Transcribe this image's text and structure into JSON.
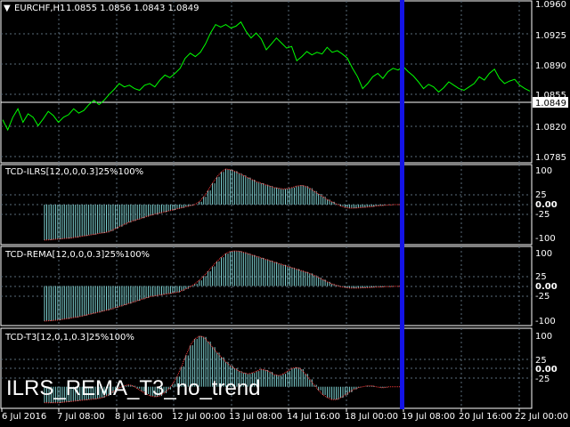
{
  "main": {
    "symbol_tf": "EURCHF,H1",
    "ohlc": "1.0855 1.0856 1.0843 1.0849",
    "price_ticks": [
      "1.0960",
      "1.0925",
      "1.0890",
      "1.0855",
      "1.0820",
      "1.0785"
    ],
    "current_price": "1.0849"
  },
  "indicators": [
    {
      "label": "TCD-ILRS[12,0,0,0.3]25%100%",
      "ticks": [
        "100",
        "25",
        "0.00",
        "-25",
        "-100"
      ]
    },
    {
      "label": "TCD-REMA[12,0,0,0.3]25%100%",
      "ticks": [
        "100",
        "25",
        "0.00",
        "-25",
        "-100"
      ]
    },
    {
      "label": "TCD-T3[12,0,1,0.3]25%100%",
      "ticks": [
        "100",
        "25",
        "0.00",
        "-25"
      ]
    }
  ],
  "overlay_title": "ILRS_REMA_T3_no_trend",
  "time_labels": [
    "6 Jul 2016",
    "7 Jul 08:00",
    "8 Jul 16:00",
    "12 Jul 00:00",
    "13 Jul 08:00",
    "14 Jul 16:00",
    "18 Jul 00:00",
    "19 Jul 08:00",
    "20 Jul 16:00",
    "22 Jul 00:00"
  ],
  "colors": {
    "price_line": "#00ff00",
    "histogram": "#7fd3d3",
    "signal": "#ff3b3b",
    "cursor": "#1010e0",
    "grid": "#5a6b7a",
    "frame": "#ffffff"
  },
  "chart_data": [
    {
      "type": "line",
      "name": "EURCHF H1 close",
      "ylim": [
        1.0775,
        1.0965
      ],
      "values": [
        1.0825,
        1.0813,
        1.0828,
        1.0838,
        1.0822,
        1.0832,
        1.0828,
        1.0818,
        1.0826,
        1.0835,
        1.083,
        1.0822,
        1.0828,
        1.0831,
        1.0838,
        1.0833,
        1.0836,
        1.0843,
        1.0848,
        1.0843,
        1.0848,
        1.0855,
        1.0861,
        1.0868,
        1.0864,
        1.0866,
        1.0862,
        1.086,
        1.0866,
        1.0868,
        1.0864,
        1.0872,
        1.0878,
        1.0875,
        1.088,
        1.0886,
        1.0898,
        1.0904,
        1.09,
        1.0905,
        1.0915,
        1.0928,
        1.0938,
        1.0935,
        1.0938,
        1.0934,
        1.0936,
        1.0941,
        1.093,
        1.0922,
        1.0928,
        1.0921,
        1.0908,
        1.0915,
        1.0922,
        1.0916,
        1.091,
        1.0912,
        1.0895,
        1.09,
        1.0906,
        1.0902,
        1.0905,
        1.0903,
        1.0911,
        1.0905,
        1.0907,
        1.0903,
        1.0898,
        1.0886,
        1.0876,
        1.0862,
        1.0868,
        1.0876,
        1.088,
        1.0874,
        1.0882,
        1.0886,
        1.0884,
        1.0888,
        1.0882,
        1.0877,
        1.087,
        1.0862,
        1.0867,
        1.0864,
        1.0858,
        1.0863,
        1.087,
        1.0866,
        1.0862,
        1.086,
        1.0864,
        1.0868,
        1.0876,
        1.0872,
        1.088,
        1.0885,
        1.0874,
        1.0868,
        1.0871,
        1.0873,
        1.0866,
        1.0862,
        1.0859
      ]
    },
    {
      "type": "bar",
      "name": "TCD-ILRS",
      "ylim": [
        -110,
        110
      ],
      "values": [
        -100,
        -99,
        -98,
        -97,
        -96,
        -95,
        -94,
        -92,
        -90,
        -88,
        -86,
        -84,
        -82,
        -80,
        -78,
        -74,
        -68,
        -62,
        -56,
        -50,
        -46,
        -42,
        -38,
        -34,
        -30,
        -27,
        -24,
        -21,
        -18,
        -15,
        -12,
        -9,
        -6,
        -3,
        0,
        8,
        22,
        40,
        60,
        78,
        92,
        100,
        98,
        94,
        88,
        82,
        76,
        70,
        64,
        60,
        56,
        52,
        48,
        46,
        44,
        45,
        48,
        52,
        54,
        52,
        46,
        38,
        30,
        22,
        14,
        8,
        2,
        -4,
        -8,
        -10,
        -10,
        -9,
        -8,
        -7,
        -6,
        -4,
        -3,
        -2,
        -1,
        0,
        0,
        0
      ]
    },
    {
      "type": "bar",
      "name": "TCD-REMA",
      "ylim": [
        -110,
        110
      ],
      "values": [
        -100,
        -99,
        -98,
        -97,
        -95,
        -93,
        -91,
        -89,
        -87,
        -84,
        -81,
        -78,
        -75,
        -72,
        -69,
        -66,
        -62,
        -58,
        -54,
        -50,
        -46,
        -42,
        -38,
        -34,
        -30,
        -28,
        -26,
        -24,
        -22,
        -20,
        -18,
        -14,
        -8,
        -2,
        6,
        16,
        28,
        42,
        56,
        70,
        82,
        92,
        98,
        100,
        99,
        96,
        92,
        88,
        84,
        80,
        76,
        72,
        68,
        64,
        60,
        56,
        52,
        48,
        44,
        40,
        36,
        30,
        24,
        18,
        12,
        6,
        2,
        -2,
        -4,
        -6,
        -6,
        -6,
        -5,
        -5,
        -4,
        -3,
        -3,
        -2,
        -2,
        -1,
        -1,
        0
      ]
    },
    {
      "type": "bar",
      "name": "TCD-T3",
      "ylim": [
        -45,
        125
      ],
      "values": [
        -35,
        -35,
        -35,
        -35,
        -34,
        -33,
        -32,
        -31,
        -30,
        -29,
        -28,
        -27,
        -26,
        -24,
        -20,
        -14,
        -8,
        -2,
        2,
        4,
        2,
        -4,
        -10,
        -16,
        -20,
        -22,
        -20,
        -14,
        -6,
        6,
        22,
        44,
        68,
        90,
        104,
        110,
        108,
        98,
        86,
        74,
        64,
        54,
        46,
        40,
        34,
        30,
        28,
        30,
        34,
        38,
        36,
        32,
        26,
        24,
        28,
        34,
        40,
        42,
        38,
        28,
        16,
        4,
        -8,
        -18,
        -24,
        -28,
        -28,
        -24,
        -18,
        -12,
        -6,
        -2,
        0,
        2,
        2,
        0,
        -2,
        -2,
        0,
        0,
        0,
        0
      ]
    }
  ]
}
